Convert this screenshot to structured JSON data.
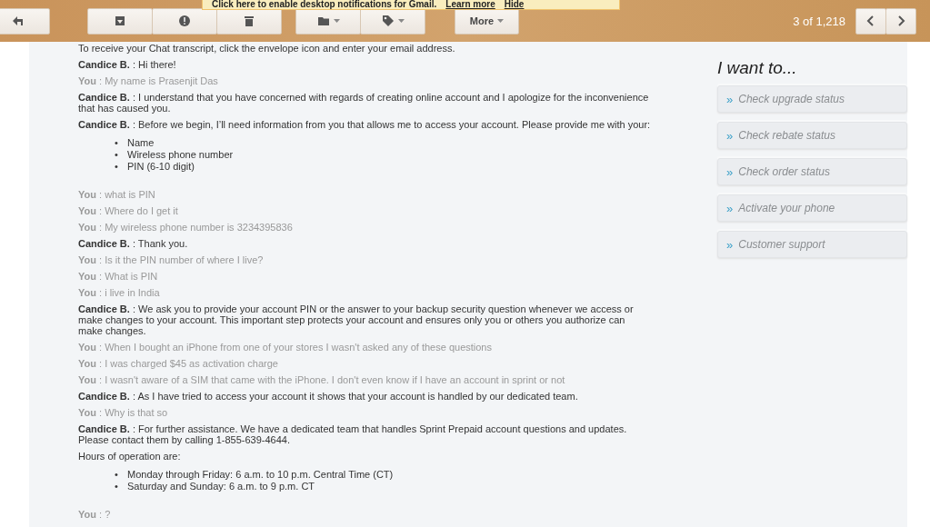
{
  "notification": {
    "text": "Click here to enable desktop notifications for Gmail.",
    "links": [
      "Learn more",
      "Hide"
    ]
  },
  "toolbar": {
    "more": "More",
    "counter": "3 of 1,218"
  },
  "intro": "To receive your Chat transcript, click the envelope icon and enter your email address.",
  "messages": [
    {
      "kind": "agent",
      "text": "**Candice B.** : Hi there!"
    },
    {
      "kind": "user",
      "text": "**You** : My name is Prasenjit Das"
    },
    {
      "kind": "agent",
      "text": "**Candice B.** : I understand that you have concerned with regards of creating online account and I apologize for the inconvenience that has caused you."
    },
    {
      "kind": "agent",
      "text": "**Candice B.** : Before we begin, I’ll need information from you that allows me to access your account. Please provide me with your:",
      "bullets": [
        {
          "marker": "•",
          "text": "Name"
        },
        {
          "marker": "•",
          "text": "Wireless phone number"
        },
        {
          "marker": "•",
          "text": "PIN (6-10 digit)"
        }
      ]
    },
    {
      "kind": "user",
      "text": "**You** : what is PIN"
    },
    {
      "kind": "user",
      "text": "**You** : Where do I get it"
    },
    {
      "kind": "user",
      "text": "**You** : My wireless phone number is 3234395836"
    },
    {
      "kind": "agent",
      "text": "**Candice B.** : Thank you."
    },
    {
      "kind": "user",
      "text": "**You** : Is it the PIN number of where I live?"
    },
    {
      "kind": "user",
      "text": "**You** : What is PIN"
    },
    {
      "kind": "user",
      "text": "**You** : i live in India"
    },
    {
      "kind": "agent",
      "text": "**Candice B.** : We ask you to provide your account PIN or the answer to your backup security question whenever we access or make changes to your account. This important step protects your account and ensures only you or others you authorize can make changes."
    },
    {
      "kind": "user",
      "text": "**You** : When I bought an iPhone from one of your stores I wasn't asked any of these questions"
    },
    {
      "kind": "user",
      "text": "**You** : I was charged $45 as activation charge"
    },
    {
      "kind": "user",
      "text": "**You** : I wasn't aware of a SIM that came with the iPhone. I don't even know if I have an account in sprint or not"
    },
    {
      "kind": "agent",
      "text": "**Candice B.** : As I have tried to access your account it shows that your account is handled by our dedicated team."
    },
    {
      "kind": "user",
      "text": "**You** : Why is that so"
    },
    {
      "kind": "agent",
      "text": "**Candice B.** : For further assistance. We have a dedicated team that handles Sprint Prepaid account questions and updates. Please contact them by calling 1-855-639-4644."
    },
    {
      "kind": "note",
      "text": "Hours of operation are:",
      "bullets": [
        {
          "marker": "•",
          "text": "Monday through Friday: 6 a.m. to 10 p.m. Central Time (CT)"
        },
        {
          "marker": "•",
          "text": "Saturday and Sunday: 6 a.m. to 9 p.m. CT"
        }
      ]
    },
    {
      "kind": "user",
      "text": "**You** : ?"
    }
  ],
  "sidebar": {
    "title": "I want to...",
    "items": [
      {
        "marker": "»",
        "label": "Check upgrade status"
      },
      {
        "marker": "»",
        "label": "Check rebate status"
      },
      {
        "marker": "»",
        "label": "Check order status"
      },
      {
        "marker": "»",
        "label": "Activate your phone"
      },
      {
        "marker": "»",
        "label": "Customer support"
      }
    ]
  }
}
